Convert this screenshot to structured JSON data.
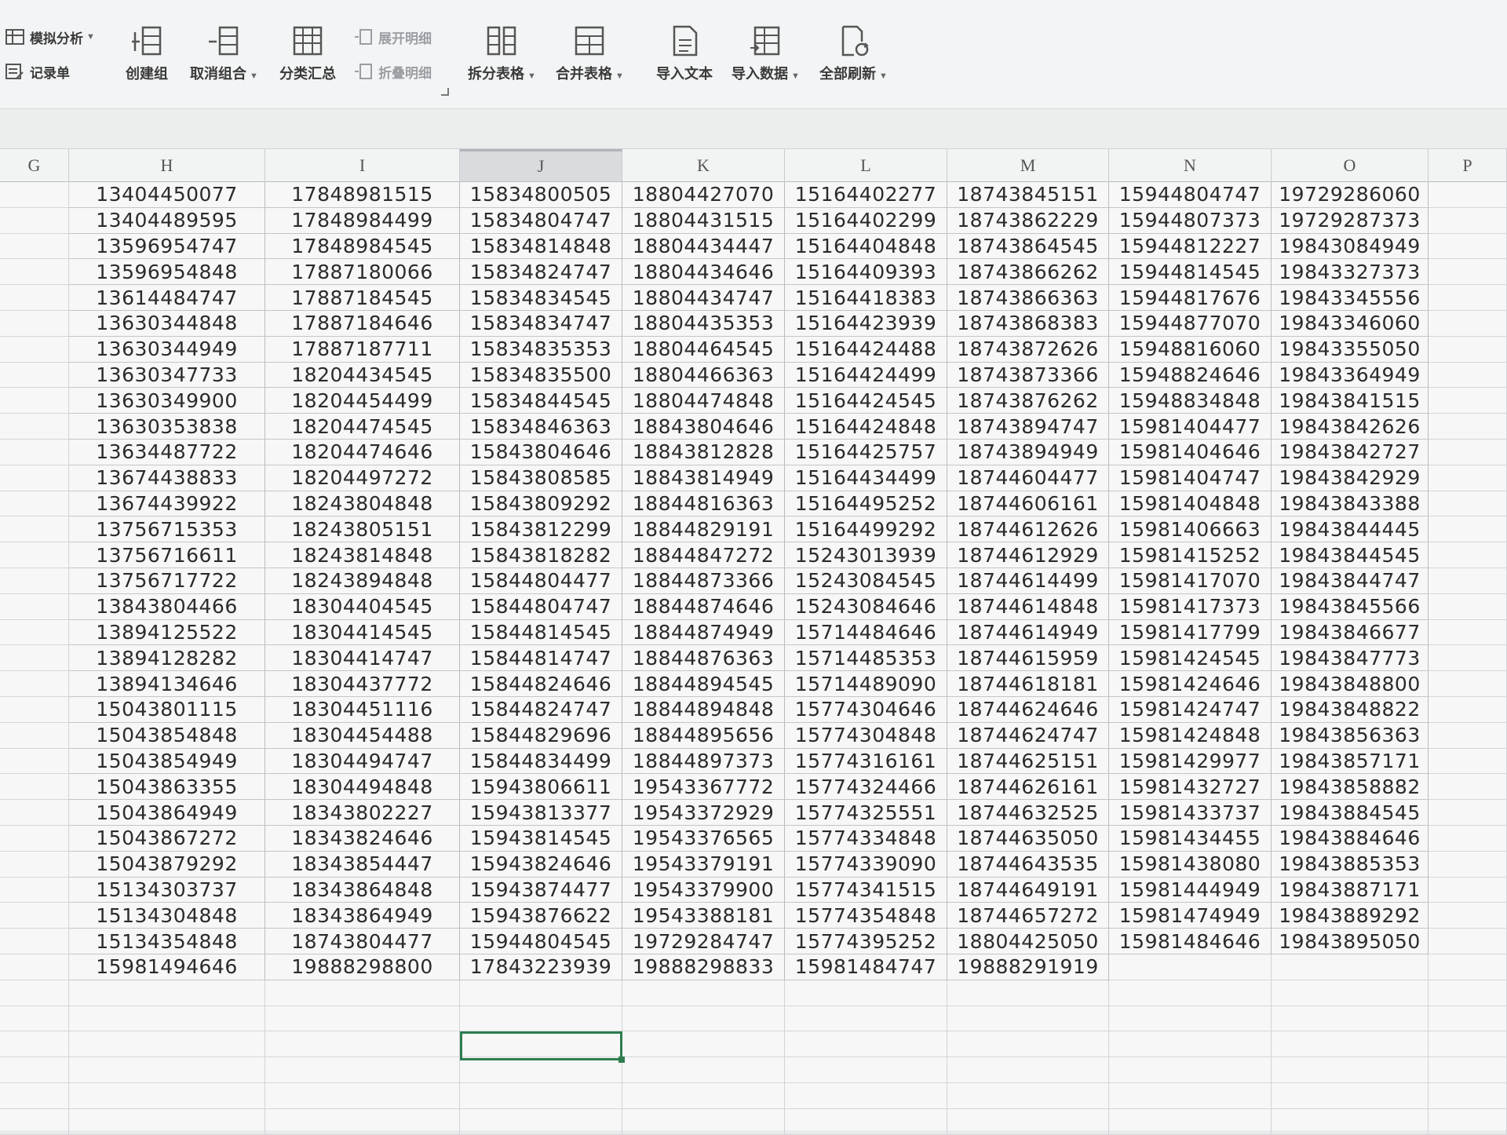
{
  "ribbon": {
    "what_if": "模拟分析",
    "record_form": "记录单",
    "create_group": "创建组",
    "ungroup": "取消组合",
    "subtotal": "分类汇总",
    "expand_detail": "展开明细",
    "collapse_detail": "折叠明细",
    "split_table": "拆分表格",
    "merge_table": "合并表格",
    "import_text": "导入文本",
    "import_data": "导入数据",
    "refresh_all": "全部刷新"
  },
  "columns": [
    "G",
    "H",
    "I",
    "J",
    "K",
    "L",
    "M",
    "N",
    "O",
    "P"
  ],
  "selected_column": "J",
  "table": {
    "H": [
      "13404450077",
      "13404489595",
      "13596954747",
      "13596954848",
      "13614484747",
      "13630344848",
      "13630344949",
      "13630347733",
      "13630349900",
      "13630353838",
      "13634487722",
      "13674438833",
      "13674439922",
      "13756715353",
      "13756716611",
      "13756717722",
      "13843804466",
      "13894125522",
      "13894128282",
      "13894134646",
      "15043801115",
      "15043854848",
      "15043854949",
      "15043863355",
      "15043864949",
      "15043867272",
      "15043879292",
      "15134303737",
      "15134304848",
      "15134354848",
      "15981494646"
    ],
    "I": [
      "17848981515",
      "17848984499",
      "17848984545",
      "17887180066",
      "17887184545",
      "17887184646",
      "17887187711",
      "18204434545",
      "18204454499",
      "18204474545",
      "18204474646",
      "18204497272",
      "18243804848",
      "18243805151",
      "18243814848",
      "18243894848",
      "18304404545",
      "18304414545",
      "18304414747",
      "18304437772",
      "18304451116",
      "18304454488",
      "18304494747",
      "18304494848",
      "18343802227",
      "18343824646",
      "18343854447",
      "18343864848",
      "18343864949",
      "18743804477",
      "19888298800"
    ],
    "J": [
      "15834800505",
      "15834804747",
      "15834814848",
      "15834824747",
      "15834834545",
      "15834834747",
      "15834835353",
      "15834835500",
      "15834844545",
      "15834846363",
      "15843804646",
      "15843808585",
      "15843809292",
      "15843812299",
      "15843818282",
      "15844804477",
      "15844804747",
      "15844814545",
      "15844814747",
      "15844824646",
      "15844824747",
      "15844829696",
      "15844834499",
      "15943806611",
      "15943813377",
      "15943814545",
      "15943824646",
      "15943874477",
      "15943876622",
      "15944804545",
      "17843223939"
    ],
    "K": [
      "18804427070",
      "18804431515",
      "18804434447",
      "18804434646",
      "18804434747",
      "18804435353",
      "18804464545",
      "18804466363",
      "18804474848",
      "18843804646",
      "18843812828",
      "18843814949",
      "18844816363",
      "18844829191",
      "18844847272",
      "18844873366",
      "18844874646",
      "18844874949",
      "18844876363",
      "18844894545",
      "18844894848",
      "18844895656",
      "18844897373",
      "19543367772",
      "19543372929",
      "19543376565",
      "19543379191",
      "19543379900",
      "19543388181",
      "19729284747",
      "19888298833"
    ],
    "L": [
      "15164402277",
      "15164402299",
      "15164404848",
      "15164409393",
      "15164418383",
      "15164423939",
      "15164424488",
      "15164424499",
      "15164424545",
      "15164424848",
      "15164425757",
      "15164434499",
      "15164495252",
      "15164499292",
      "15243013939",
      "15243084545",
      "15243084646",
      "15714484646",
      "15714485353",
      "15714489090",
      "15774304646",
      "15774304848",
      "15774316161",
      "15774324466",
      "15774325551",
      "15774334848",
      "15774339090",
      "15774341515",
      "15774354848",
      "15774395252",
      "15981484747"
    ],
    "M": [
      "18743845151",
      "18743862229",
      "18743864545",
      "18743866262",
      "18743866363",
      "18743868383",
      "18743872626",
      "18743873366",
      "18743876262",
      "18743894747",
      "18743894949",
      "18744604477",
      "18744606161",
      "18744612626",
      "18744612929",
      "18744614499",
      "18744614848",
      "18744614949",
      "18744615959",
      "18744618181",
      "18744624646",
      "18744624747",
      "18744625151",
      "18744626161",
      "18744632525",
      "18744635050",
      "18744643535",
      "18744649191",
      "18744657272",
      "18804425050",
      "19888291919"
    ],
    "N": [
      "15944804747",
      "15944807373",
      "15944812227",
      "15944814545",
      "15944817676",
      "15944877070",
      "15948816060",
      "15948824646",
      "15948834848",
      "15981404477",
      "15981404646",
      "15981404747",
      "15981404848",
      "15981406663",
      "15981415252",
      "15981417070",
      "15981417373",
      "15981417799",
      "15981424545",
      "15981424646",
      "15981424747",
      "15981424848",
      "15981429977",
      "15981432727",
      "15981433737",
      "15981434455",
      "15981438080",
      "15981444949",
      "15981474949",
      "15981484646"
    ],
    "O": [
      "19729286060",
      "19729287373",
      "19843084949",
      "19843327373",
      "19843345556",
      "19843346060",
      "19843355050",
      "19843364949",
      "19843841515",
      "19843842626",
      "19843842727",
      "19843842929",
      "19843843388",
      "19843844445",
      "19843844545",
      "19843844747",
      "19843845566",
      "19843846677",
      "19843847773",
      "19843848800",
      "19843848822",
      "19843856363",
      "19843857171",
      "19843858882",
      "19843884545",
      "19843884646",
      "19843885353",
      "19843887171",
      "19843889292",
      "19843895050"
    ]
  }
}
